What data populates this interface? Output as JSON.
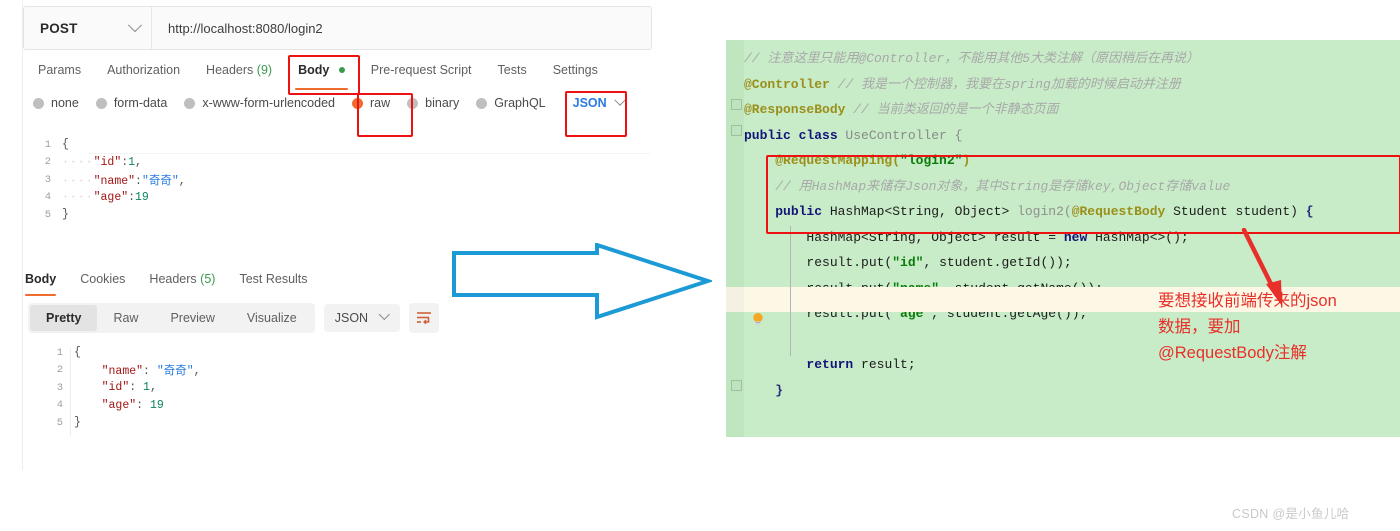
{
  "request": {
    "method": "POST",
    "url": "http://localhost:8080/login2",
    "tabs": [
      {
        "label": "Params",
        "active": false
      },
      {
        "label": "Authorization",
        "active": false
      },
      {
        "label": "Headers",
        "count": "(9)",
        "active": false
      },
      {
        "label": "Body",
        "active": true,
        "dot": true
      },
      {
        "label": "Pre-request Script",
        "active": false
      },
      {
        "label": "Tests",
        "active": false
      },
      {
        "label": "Settings",
        "active": false
      }
    ],
    "body_types": [
      {
        "label": "none",
        "selected": false
      },
      {
        "label": "form-data",
        "selected": false
      },
      {
        "label": "x-www-form-urlencoded",
        "selected": false
      },
      {
        "label": "raw",
        "selected": true
      },
      {
        "label": "binary",
        "selected": false
      },
      {
        "label": "GraphQL",
        "selected": false
      }
    ],
    "format_selected": "JSON",
    "code_lines": [
      {
        "n": "1",
        "text": "{"
      },
      {
        "n": "2",
        "text": "\"id\":1,"
      },
      {
        "n": "3",
        "text": "\"name\":\"奇奇\","
      },
      {
        "n": "4",
        "text": "\"age\":19"
      },
      {
        "n": "5",
        "text": "}"
      }
    ]
  },
  "response": {
    "tabs": [
      {
        "label": "Body",
        "active": true
      },
      {
        "label": "Cookies",
        "active": false
      },
      {
        "label": "Headers",
        "count": "(5)",
        "active": false
      },
      {
        "label": "Test Results",
        "active": false
      }
    ],
    "view_modes": [
      {
        "label": "Pretty",
        "active": true
      },
      {
        "label": "Raw",
        "active": false
      },
      {
        "label": "Preview",
        "active": false
      },
      {
        "label": "Visualize",
        "active": false
      }
    ],
    "format_selected": "JSON",
    "code_lines": [
      {
        "n": "1",
        "text": "{"
      },
      {
        "n": "2",
        "text": "\"name\": \"奇奇\","
      },
      {
        "n": "3",
        "text": "\"id\": 1,"
      },
      {
        "n": "4",
        "text": "\"age\": 19"
      },
      {
        "n": "5",
        "text": "}"
      }
    ]
  },
  "editor": {
    "lines": [
      "// 注意这里只能用@Controller，不能用其他5大类注解（原因稍后在再说）",
      "@Controller // 我是一个控制器，我要在spring加载的时候启动并注册",
      "@ResponseBody // 当前类返回的是一个非静态页面",
      "public class UseController {",
      "@RequestMapping(\"login2\")",
      "// 用HashMap来储存Json对象，其中String是存储key,Object存储value",
      "public HashMap<String, Object> login2(@RequestBody Student student) {",
      "HashMap<String, Object> result = new HashMap<>();",
      "result.put(\"id\", student.getId());",
      "result.put(\"name\", student.getName());",
      "result.put(\"age\", student.getAge());",
      "return result;",
      "}"
    ]
  },
  "annotation": {
    "line1": "要想接收前端传来的json",
    "line2": "数据，要加",
    "line3": "@RequestBody注解"
  },
  "watermark": "CSDN @是小鱼儿哈",
  "colors": {
    "accent_orange": "#ef6c2e",
    "green_dot": "#3a9b4e",
    "blue_link": "#2a7ae2",
    "annotation_red": "#e8302a",
    "box_red": "#ee1111",
    "editor_bg": "#c8ecc8",
    "arrow_blue": "#1b9ad6"
  }
}
